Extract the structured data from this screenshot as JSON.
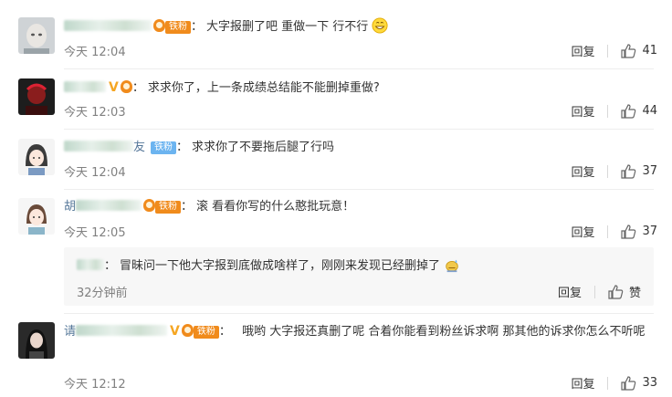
{
  "comments": [
    {
      "fan_badge": "铁粉",
      "text": "大字报删了吧 重做一下 行不行",
      "time": "今天 12:04",
      "reply": "回复",
      "likes": "41",
      "emoji": "grinning-face-icon"
    },
    {
      "text": "求求你了，上一条成绩总结能不能删掉重做?",
      "time": "今天 12:03",
      "reply": "回复",
      "likes": "44"
    },
    {
      "name_suffix": "友",
      "fan_badge": "铁粉",
      "text": "求求你了不要拖后腿了行吗",
      "time": "今天 12:04",
      "reply": "回复",
      "likes": "37"
    },
    {
      "name_prefix": "胡",
      "fan_badge": "铁粉",
      "text": "滚 看看你写的什么憨批玩意！",
      "time": "今天 12:05",
      "reply": "回复",
      "likes": "37",
      "sub_reply": {
        "text": "冒昧问一下他大字报到底做成啥样了，刚刚来发现已经删掉了",
        "time": "32分钟前",
        "reply": "回复",
        "like": "赞",
        "emoji": "sweat-emoji-icon"
      }
    },
    {
      "name_prefix": "请",
      "fan_badge": "铁粉",
      "text": "哦哟 大字报还真删了呢 合着你能看到粉丝诉求啊 那其他的诉求你怎么不听呢",
      "time": "今天 12:12",
      "reply": "回复",
      "likes": "33"
    }
  ],
  "colors": {
    "fan_badge_orange": "#f08b1c",
    "fan_badge_blue": "#6cb4f0",
    "verified_v": "#f5a623",
    "muted_text": "#808080"
  }
}
